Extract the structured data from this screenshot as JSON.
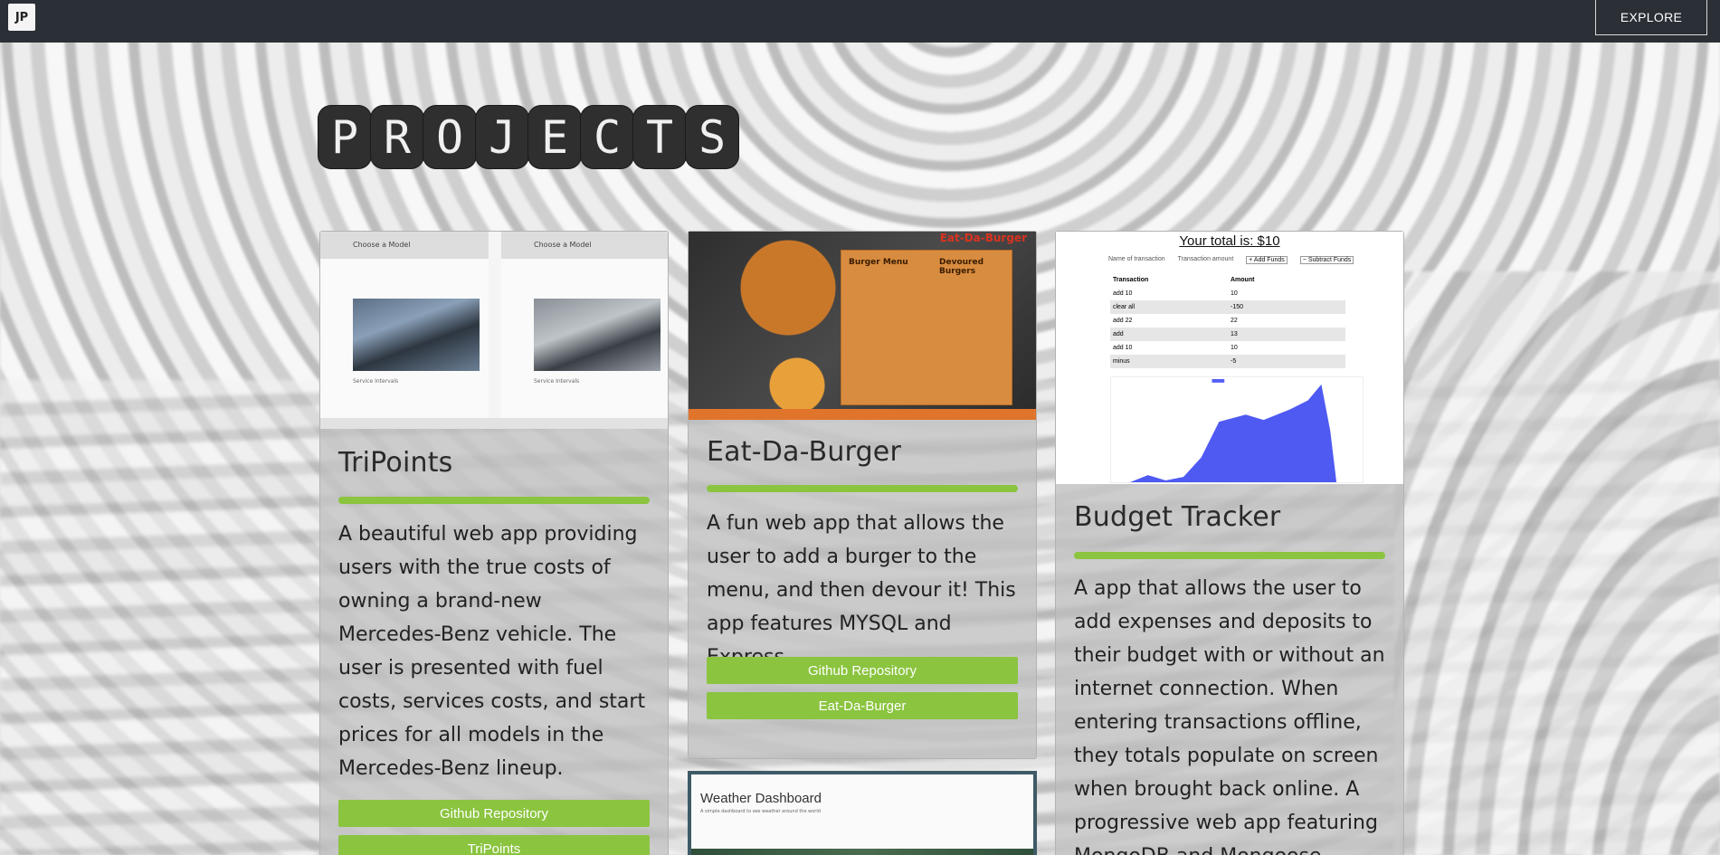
{
  "navbar": {
    "logo_text": "JP",
    "explore_label": "EXPLORE"
  },
  "page_title_letters": [
    "P",
    "R",
    "O",
    "J",
    "E",
    "C",
    "T",
    "S"
  ],
  "cards": {
    "tripoints": {
      "title": "TriPoints",
      "description": "A beautiful web app providing users with the true costs of owning a brand-new Mercedes-Benz vehicle. The user is presented with fuel costs, services costs, and start prices for all models in the Mercedes-Benz lineup.",
      "buttons": [
        "Github Repository",
        "TriPoints"
      ],
      "image": {
        "panel_label": "Choose a Model",
        "service_heading": "Service Intervals"
      }
    },
    "burger": {
      "title": "Eat-Da-Burger",
      "description": "A fun web app that allows the user to add a burger to the menu, and then devour it! This app features MYSQL and Express.",
      "buttons": [
        "Github Repository",
        "Eat-Da-Burger"
      ],
      "image": {
        "banner": "Eat-Da-Burger",
        "menu_title": "Burger Menu",
        "devoured_title": "Devoured Burgers"
      }
    },
    "budget": {
      "title": "Budget Tracker",
      "description": "A app that allows the user to add expenses and deposits to their budget with or without an internet connection. When entering transactions offline, they totals populate on screen when brought back online. A progressive web app featuring MongoDB and Mongoose.",
      "image": {
        "total": "Your total is: $10",
        "name_placeholder": "Name of transaction",
        "amount_placeholder": "Transaction amount",
        "add_funds": "+ Add Funds",
        "subtract_funds": "− Subtract Funds",
        "table_headers": [
          "Transaction",
          "Amount"
        ],
        "rows": [
          [
            "add 10",
            "10"
          ],
          [
            "clear all",
            "-150"
          ],
          [
            "add 22",
            "22"
          ],
          [
            "add",
            "13"
          ],
          [
            "add 10",
            "10"
          ],
          [
            "minus",
            "-5"
          ]
        ]
      }
    },
    "weather": {
      "title": "Weather Dashboard",
      "subtitle": "A simple dashboard to see weather around the world"
    }
  },
  "colors": {
    "navbar": "#2b2f36",
    "accent_green": "#8bc43f"
  }
}
